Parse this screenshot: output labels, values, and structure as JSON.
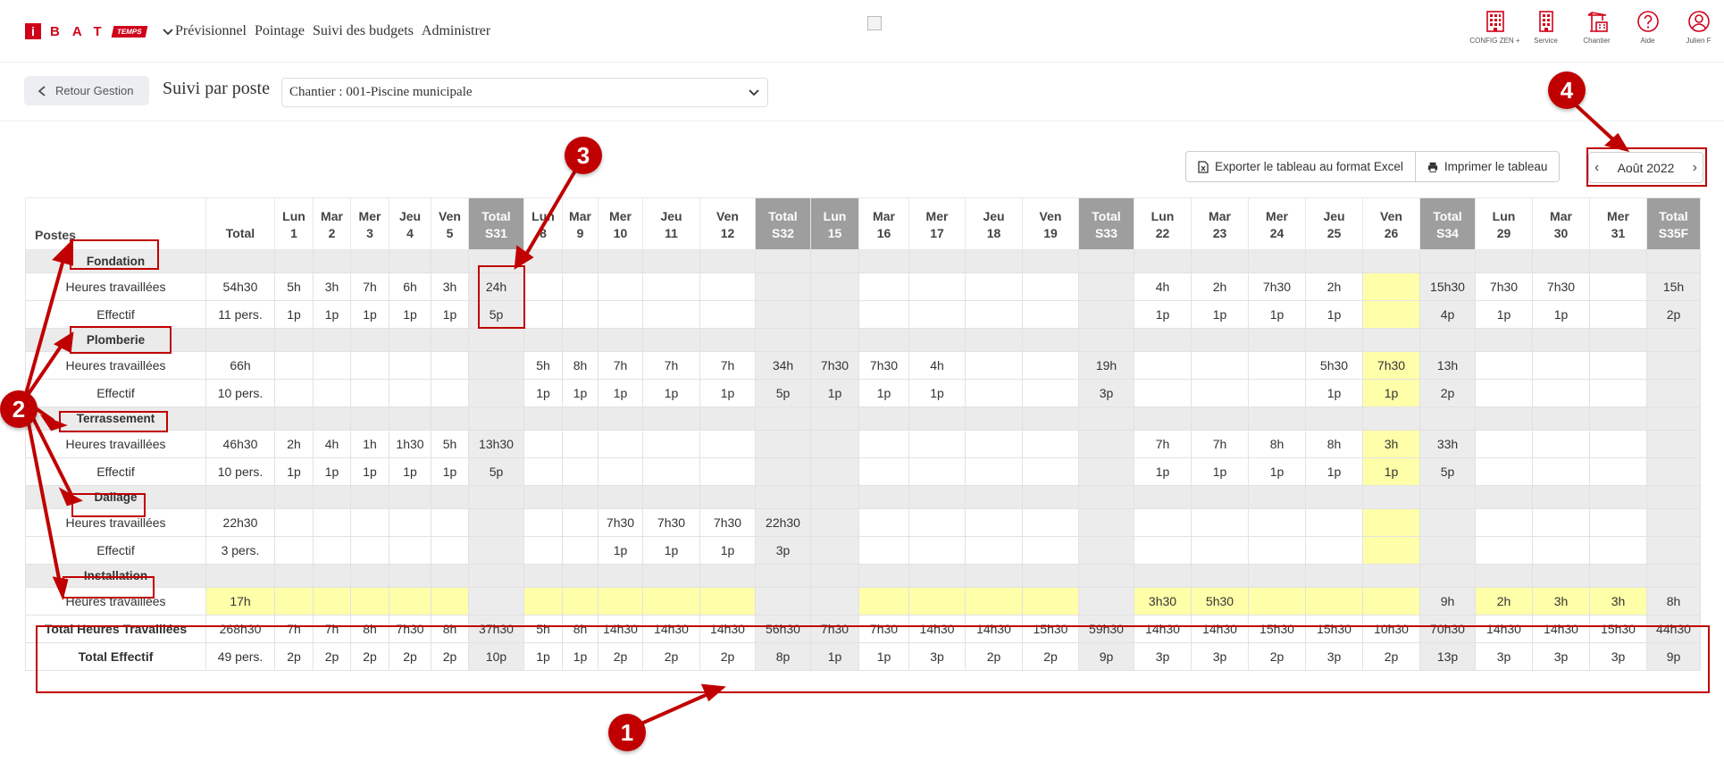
{
  "brand": {
    "logo_letter": "i",
    "logo_letters": "BAT",
    "logo_tag": "TEMPS"
  },
  "nav": [
    "Prévisionnel",
    "Pointage",
    "Suivi des budgets",
    "Administrer"
  ],
  "top_icons": [
    {
      "label": "CONFIG ZEN +",
      "icon": "building-icon"
    },
    {
      "label": "Service",
      "icon": "office-icon"
    },
    {
      "label": "Chantier",
      "icon": "crane-icon"
    },
    {
      "label": "Aide",
      "icon": "help-icon"
    },
    {
      "label": "Julien F",
      "icon": "user-icon"
    }
  ],
  "back_label": "Retour Gestion",
  "page_title": "Suivi par poste",
  "chantier_select": "Chantier : 001-Piscine municipale",
  "export_label": "Exporter le tableau au format Excel",
  "print_label": "Imprimer le tableau",
  "month_label": "Août 2022",
  "colors": {
    "accent": "#d0021b",
    "annotation": "#c00000",
    "week_header": "#9e9e9e",
    "highlight": "#ffffa9"
  },
  "table": {
    "corner": "Postes",
    "total_header": "Total",
    "columns": [
      {
        "d": "Lun",
        "n": "1"
      },
      {
        "d": "Mar",
        "n": "2"
      },
      {
        "d": "Mer",
        "n": "3"
      },
      {
        "d": "Jeu",
        "n": "4"
      },
      {
        "d": "Ven",
        "n": "5"
      },
      {
        "d": "Total",
        "n": "S31",
        "wk": true
      },
      {
        "d": "Lun",
        "n": "8"
      },
      {
        "d": "Mar",
        "n": "9"
      },
      {
        "d": "Mer",
        "n": "10"
      },
      {
        "d": "Jeu",
        "n": "11"
      },
      {
        "d": "Ven",
        "n": "12"
      },
      {
        "d": "Total",
        "n": "S32",
        "wk": true
      },
      {
        "d": "Lun",
        "n": "15",
        "wk": true
      },
      {
        "d": "Mar",
        "n": "16"
      },
      {
        "d": "Mer",
        "n": "17"
      },
      {
        "d": "Jeu",
        "n": "18"
      },
      {
        "d": "Ven",
        "n": "19"
      },
      {
        "d": "Total",
        "n": "S33",
        "wk": true
      },
      {
        "d": "Lun",
        "n": "22"
      },
      {
        "d": "Mar",
        "n": "23"
      },
      {
        "d": "Mer",
        "n": "24"
      },
      {
        "d": "Jeu",
        "n": "25"
      },
      {
        "d": "Ven",
        "n": "26"
      },
      {
        "d": "Total",
        "n": "S34",
        "wk": true
      },
      {
        "d": "Lun",
        "n": "29"
      },
      {
        "d": "Mar",
        "n": "30"
      },
      {
        "d": "Mer",
        "n": "31"
      },
      {
        "d": "Total",
        "n": "S35F",
        "wk": true
      }
    ],
    "sections": [
      {
        "name": "Fondation",
        "hours": {
          "label": "Heures travaillées",
          "total": "54h30",
          "cells": [
            "5h",
            "3h",
            "7h",
            "6h",
            "3h",
            "24h",
            "",
            "",
            "",
            "",
            "",
            "",
            "",
            "",
            "",
            "",
            "",
            "",
            "4h",
            "2h",
            "7h30",
            "2h",
            "",
            "15h30",
            "7h30",
            "7h30",
            "",
            "15h"
          ]
        },
        "staff": {
          "label": "Effectif",
          "total": "11 pers.",
          "cells": [
            "1p",
            "1p",
            "1p",
            "1p",
            "1p",
            "5p",
            "",
            "",
            "",
            "",
            "",
            "",
            "",
            "",
            "",
            "",
            "",
            "",
            "1p",
            "1p",
            "1p",
            "1p",
            "",
            "4p",
            "1p",
            "1p",
            "",
            "2p"
          ]
        }
      },
      {
        "name": "Plomberie",
        "hours": {
          "label": "Heures travaillées",
          "total": "66h",
          "cells": [
            "",
            "",
            "",
            "",
            "",
            "",
            "5h",
            "8h",
            "7h",
            "7h",
            "7h",
            "34h",
            "7h30",
            "7h30",
            "4h",
            "",
            "",
            "19h",
            "",
            "",
            "",
            "5h30",
            "7h30",
            "13h",
            "",
            "",
            "",
            ""
          ]
        },
        "staff": {
          "label": "Effectif",
          "total": "10 pers.",
          "cells": [
            "",
            "",
            "",
            "",
            "",
            "",
            "1p",
            "1p",
            "1p",
            "1p",
            "1p",
            "5p",
            "1p",
            "1p",
            "1p",
            "",
            "",
            "3p",
            "",
            "",
            "",
            "1p",
            "1p",
            "2p",
            "",
            "",
            "",
            ""
          ]
        }
      },
      {
        "name": "Terrassement",
        "hours": {
          "label": "Heures travaillées",
          "total": "46h30",
          "cells": [
            "2h",
            "4h",
            "1h",
            "1h30",
            "5h",
            "13h30",
            "",
            "",
            "",
            "",
            "",
            "",
            "",
            "",
            "",
            "",
            "",
            "",
            "7h",
            "7h",
            "8h",
            "8h",
            "3h",
            "33h",
            "",
            "",
            "",
            ""
          ]
        },
        "staff": {
          "label": "Effectif",
          "total": "10 pers.",
          "cells": [
            "1p",
            "1p",
            "1p",
            "1p",
            "1p",
            "5p",
            "",
            "",
            "",
            "",
            "",
            "",
            "",
            "",
            "",
            "",
            "",
            "",
            "1p",
            "1p",
            "1p",
            "1p",
            "1p",
            "5p",
            "",
            "",
            "",
            ""
          ]
        }
      },
      {
        "name": "Dallage",
        "hours": {
          "label": "Heures travaillées",
          "total": "22h30",
          "cells": [
            "",
            "",
            "",
            "",
            "",
            "",
            "",
            "",
            "7h30",
            "7h30",
            "7h30",
            "22h30",
            "",
            "",
            "",
            "",
            "",
            "",
            "",
            "",
            "",
            "",
            "",
            "",
            "",
            "",
            "",
            ""
          ]
        },
        "staff": {
          "label": "Effectif",
          "total": "3 pers.",
          "cells": [
            "",
            "",
            "",
            "",
            "",
            "",
            "",
            "",
            "1p",
            "1p",
            "1p",
            "3p",
            "",
            "",
            "",
            "",
            "",
            "",
            "",
            "",
            "",
            "",
            "",
            "",
            "",
            "",
            "",
            ""
          ]
        }
      },
      {
        "name": "Installation",
        "hours": {
          "label": "Heures travaillées",
          "total": "17h",
          "cells": [
            "",
            "",
            "",
            "",
            "",
            "",
            "",
            "",
            "",
            "",
            "",
            "",
            "",
            "",
            "",
            "",
            "",
            "",
            "3h30",
            "5h30",
            "",
            "",
            "",
            "9h",
            "2h",
            "3h",
            "3h",
            "8h"
          ]
        }
      }
    ],
    "total_hours": {
      "label": "Total Heures Travaillées",
      "total": "268h30",
      "cells": [
        "7h",
        "7h",
        "8h",
        "7h30",
        "8h",
        "37h30",
        "5h",
        "8h",
        "14h30",
        "14h30",
        "14h30",
        "56h30",
        "7h30",
        "7h30",
        "14h30",
        "14h30",
        "15h30",
        "59h30",
        "14h30",
        "14h30",
        "15h30",
        "15h30",
        "10h30",
        "70h30",
        "14h30",
        "14h30",
        "15h30",
        "44h30"
      ]
    },
    "total_staff": {
      "label": "Total Effectif",
      "total": "49 pers.",
      "cells": [
        "2p",
        "2p",
        "2p",
        "2p",
        "2p",
        "10p",
        "1p",
        "1p",
        "2p",
        "2p",
        "2p",
        "8p",
        "1p",
        "1p",
        "3p",
        "2p",
        "2p",
        "9p",
        "3p",
        "3p",
        "2p",
        "3p",
        "2p",
        "13p",
        "3p",
        "3p",
        "3p",
        "9p"
      ]
    }
  },
  "annotations": [
    "1",
    "2",
    "3",
    "4"
  ]
}
